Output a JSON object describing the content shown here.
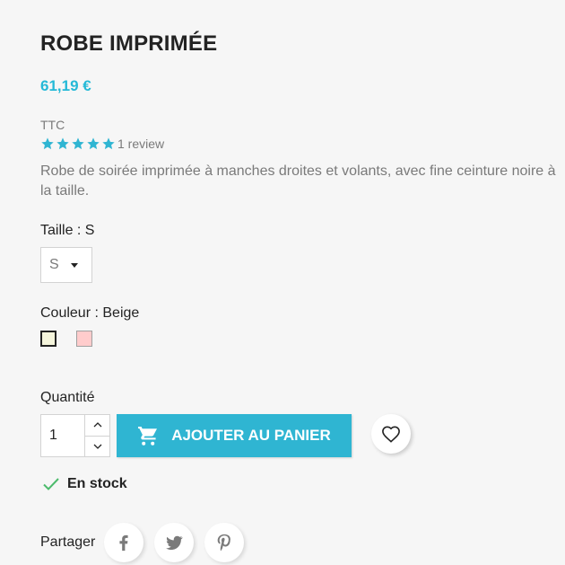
{
  "product": {
    "title": "ROBE IMPRIMÉE",
    "price": "61,19 €",
    "tax_label": "TTC",
    "rating": {
      "stars": 5,
      "max": 5,
      "review_text": "1 review"
    },
    "description": "Robe de soirée imprimée à manches droites et volants, avec fine ceinture noire à la taille."
  },
  "variants": {
    "size_label": "Taille : S",
    "size_selected": "S",
    "color_label": "Couleur : Beige",
    "colors": [
      {
        "name": "Beige",
        "hex": "#f5f5dc",
        "selected": true
      },
      {
        "name": "Pink",
        "hex": "#ffcccc",
        "selected": false
      }
    ]
  },
  "purchase": {
    "quantity_label": "Quantité",
    "quantity_value": "1",
    "add_to_cart_label": "AJOUTER AU PANIER",
    "stock_status": "En stock"
  },
  "share": {
    "label": "Partager",
    "networks": [
      "facebook-icon",
      "twitter-icon",
      "pinterest-icon"
    ]
  },
  "colors": {
    "accent": "#2fb5d2",
    "price": "#24b9d7",
    "star": "#2fb5d2",
    "stock_check": "#4cbb6c"
  }
}
